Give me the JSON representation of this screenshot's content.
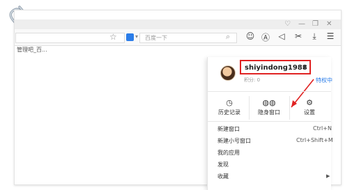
{
  "window": {
    "controls": [
      "♡",
      "—",
      "❐",
      "✕"
    ]
  },
  "toolbar": {
    "search_placeholder": "百度一下",
    "star_icon": "star-icon",
    "icons": [
      "chat-icon",
      "a-circle-icon",
      "speaker-icon",
      "scissors-icon",
      "download-icon",
      "menu-icon"
    ],
    "icon_glyphs": [
      "☺",
      "Ⓐ",
      "◁",
      "✂",
      "⤓",
      "☰"
    ]
  },
  "bookmarks": {
    "item": "管理吧_百..."
  },
  "menu": {
    "username": "shiyindong1988",
    "caret": "▼",
    "points": "积分: 0",
    "privilege": "特权中",
    "quick_actions": [
      {
        "label": "历史记录",
        "icon": "clock-icon",
        "glyph": "◷"
      },
      {
        "label": "隐身窗口",
        "icon": "mask-icon",
        "glyph": "◍◍"
      },
      {
        "label": "设置",
        "icon": "gear-icon",
        "glyph": "⚙"
      }
    ],
    "items": [
      {
        "label": "新建窗口",
        "shortcut": "Ctrl+N"
      },
      {
        "label": "新建小号窗口",
        "shortcut": "Ctrl+Shift+M"
      },
      {
        "label": "我的应用",
        "shortcut": ""
      },
      {
        "label": "发现",
        "shortcut": ""
      },
      {
        "label": "收藏",
        "shortcut": "▶"
      }
    ]
  },
  "colors": {
    "highlight_red": "#e02222",
    "link_blue": "#2b7de9"
  }
}
